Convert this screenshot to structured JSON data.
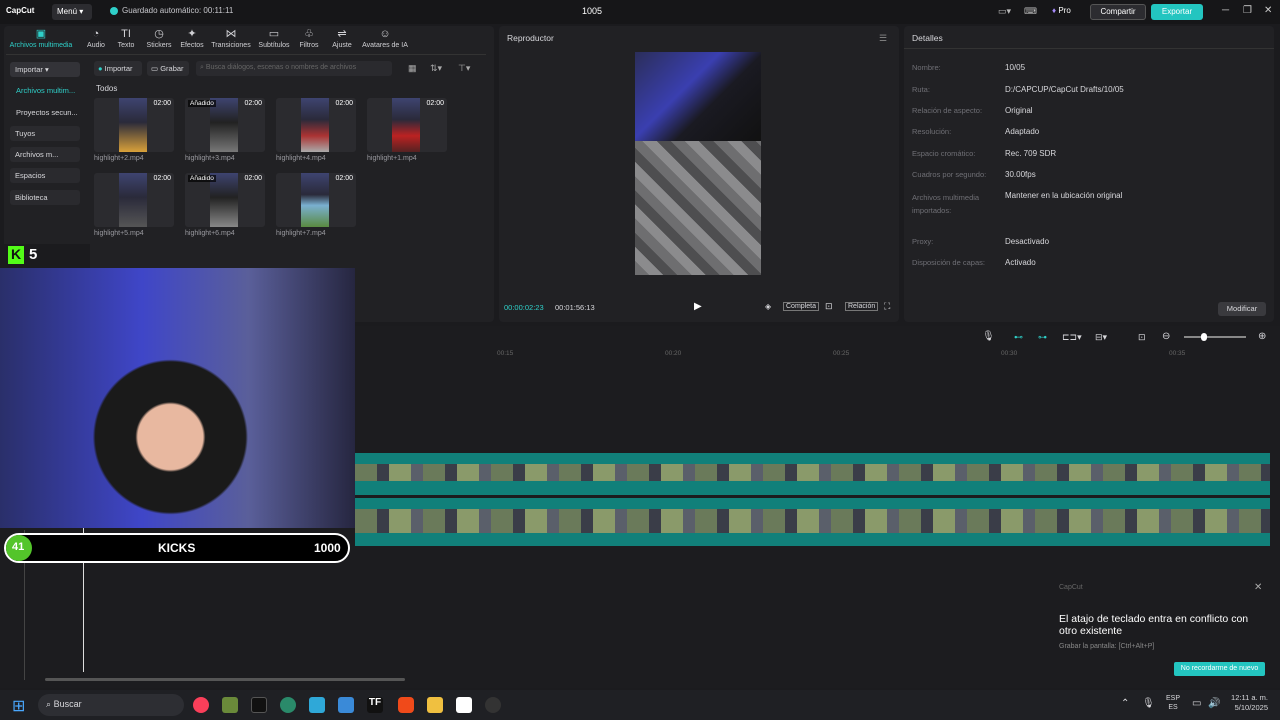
{
  "app": {
    "logo": "CapCut",
    "menu": "Menú",
    "autosave": "Guardado automático: 00:11:11",
    "title": "1005",
    "pro": "Pro",
    "share": "Compartir",
    "export": "Exportar"
  },
  "toolbar": [
    {
      "label": "Archivos multimedia",
      "icon": "media-icon"
    },
    {
      "label": "Audio",
      "icon": "audio-icon"
    },
    {
      "label": "Texto",
      "icon": "text-icon"
    },
    {
      "label": "Stickers",
      "icon": "sticker-icon"
    },
    {
      "label": "Efectos",
      "icon": "effects-icon"
    },
    {
      "label": "Transiciones",
      "icon": "transition-icon"
    },
    {
      "label": "Subtítulos",
      "icon": "subtitle-icon"
    },
    {
      "label": "Filtros",
      "icon": "filter-icon"
    },
    {
      "label": "Ajuste",
      "icon": "adjust-icon"
    },
    {
      "label": "Avatares de IA",
      "icon": "avatar-icon"
    }
  ],
  "sidebar": [
    "Importar",
    "Archivos multim...",
    "Proyectos secun...",
    "Tuyos",
    "Archivos m...",
    "Espacios",
    "Biblioteca"
  ],
  "media": {
    "import": "Importar",
    "record": "Grabar",
    "search_placeholder": "Busca diálogos, escenas o nombres de archivos",
    "all": "Todos",
    "items": [
      {
        "name": "highlight+2.mp4",
        "dur": "02:00",
        "added": ""
      },
      {
        "name": "highlight+3.mp4",
        "dur": "02:00",
        "added": "Añadido"
      },
      {
        "name": "highlight+4.mp4",
        "dur": "02:00",
        "added": ""
      },
      {
        "name": "highlight+1.mp4",
        "dur": "02:00",
        "added": ""
      },
      {
        "name": "highlight+5.mp4",
        "dur": "02:00",
        "added": ""
      },
      {
        "name": "highlight+6.mp4",
        "dur": "02:00",
        "added": "Añadido"
      },
      {
        "name": "highlight+7.mp4",
        "dur": "02:00",
        "added": ""
      }
    ]
  },
  "player": {
    "title": "Reproductor",
    "current": "00:00:02:23",
    "total": "00:01:56:13",
    "full": "Completa",
    "ratio": "Relación"
  },
  "details": {
    "title": "Detalles",
    "rows": [
      {
        "k": "Nombre:",
        "v": "10/05"
      },
      {
        "k": "Ruta:",
        "v": "D:/CAPCUP/CapCut Drafts/10/05"
      },
      {
        "k": "Relación de aspecto:",
        "v": "Original"
      },
      {
        "k": "Resolución:",
        "v": "Adaptado"
      },
      {
        "k": "Espacio cromático:",
        "v": "Rec. 709 SDR"
      },
      {
        "k": "Cuadros por segundo:",
        "v": "30.00fps"
      },
      {
        "k": "Archivos multimedia importados:",
        "v": "Mantener en la ubicación original"
      },
      {
        "k": "Proxy:",
        "v": "Desactivado"
      },
      {
        "k": "Disposición de capas:",
        "v": "Activado"
      }
    ],
    "modify": "Modificar"
  },
  "timeline": {
    "ticks": [
      "00:15",
      "00:20",
      "00:25",
      "00:30",
      "00:35"
    ]
  },
  "overlay": {
    "k_count": "5",
    "kicks_current": "41",
    "kicks_label": "KICKS",
    "kicks_goal": "1000",
    "kicks_progress": 0.041
  },
  "toast": {
    "brand": "CapCut",
    "title": "El atajo de teclado entra en conflicto con otro existente",
    "detail": "Grabar la pantalla: [Ctrl+Alt+P]",
    "button": "No recordarme de nuevo"
  },
  "taskbar": {
    "search": "Buscar",
    "lang1": "ESP",
    "lang2": "ES",
    "time": "12:11 a. m.",
    "date": "5/10/2025"
  }
}
